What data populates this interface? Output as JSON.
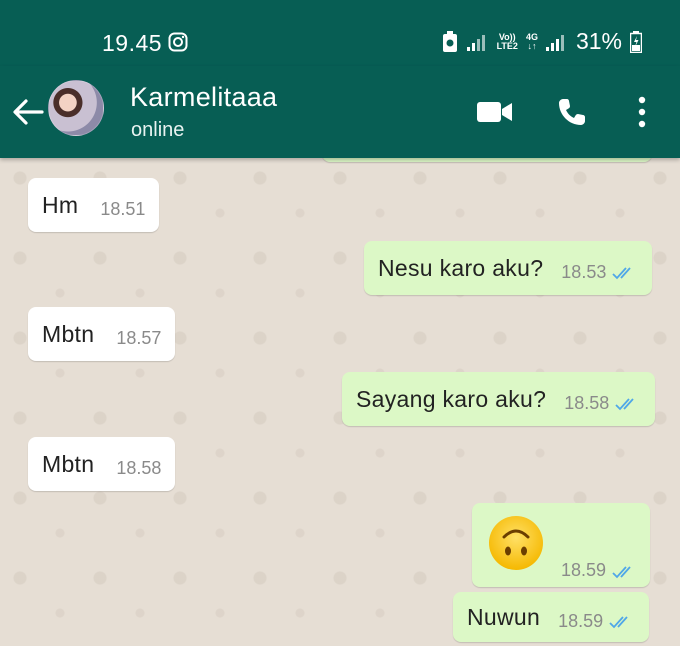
{
  "status_bar": {
    "time": "19.45",
    "network_top": "Vo))",
    "network_bottom": "LTE2",
    "net_gen": "4G",
    "battery": "31%"
  },
  "header": {
    "contact_name": "Karmelitaaa",
    "contact_status": "online"
  },
  "messages": [
    {
      "direction": "in",
      "text": "Hm",
      "time": "18.51"
    },
    {
      "direction": "out",
      "text": "Nesu karo aku?",
      "time": "18.53",
      "read": true
    },
    {
      "direction": "in",
      "text": "Mbtn",
      "time": "18.57"
    },
    {
      "direction": "out",
      "text": "Sayang karo aku?",
      "time": "18.58",
      "read": true
    },
    {
      "direction": "in",
      "text": "Mbtn",
      "time": "18.58"
    },
    {
      "direction": "out",
      "emoji": "upside-down-face",
      "time": "18.59",
      "read": true
    },
    {
      "direction": "out",
      "text": "Nuwun",
      "time": "18.59",
      "read": true
    }
  ],
  "colors": {
    "header_bg": "#075e54",
    "outgoing_bubble": "#dcf8c6",
    "incoming_bubble": "#ffffff",
    "read_ticks": "#34b7f1"
  }
}
